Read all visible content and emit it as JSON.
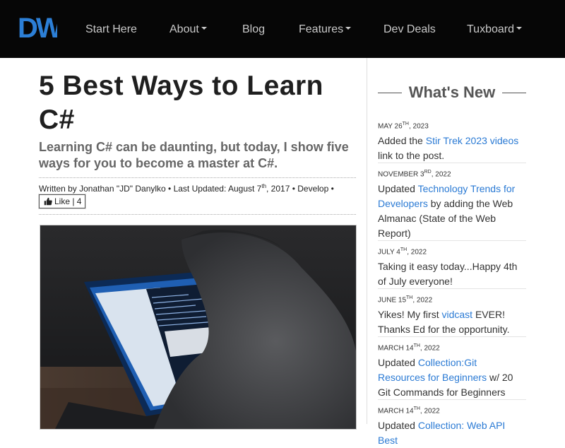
{
  "nav": {
    "logo": "DW",
    "brand_color": "#2c7fd6",
    "items": [
      {
        "label": "Start Here",
        "dropdown": false
      },
      {
        "label": "About",
        "dropdown": true
      },
      {
        "label": "Blog",
        "dropdown": false
      },
      {
        "label": "Features",
        "dropdown": true
      },
      {
        "label": "Dev Deals",
        "dropdown": false
      },
      {
        "label": "Tuxboard",
        "dropdown": true
      }
    ]
  },
  "article": {
    "title": "5 Best Ways to Learn C#",
    "subtitle": "Learning C# can be daunting, but today, I show five ways for you to become a master at C#.",
    "byline_prefix": "Written by Jonathan \"JD\" Danylko • Last Updated: August 7",
    "byline_sup": "th",
    "byline_suffix": ", 2017 • Develop •",
    "like_label": "Like | 4",
    "like_icon": "thumbs-up-icon",
    "image_alt": "Person coding on a laptop"
  },
  "sidebar": {
    "heading": "What's New",
    "link_color": "#2a7ad4",
    "items": [
      {
        "date_pre": "May 26",
        "date_sup": "th",
        "date_post": ", 2023",
        "before": "Added the ",
        "link": "Stir Trek 2023 videos",
        "after": " link to the post."
      },
      {
        "date_pre": "November 3",
        "date_sup": "rd",
        "date_post": ", 2022",
        "before": "Updated ",
        "link": "Technology Trends for Developers",
        "after": " by adding the Web Almanac (State of the Web Report)"
      },
      {
        "date_pre": "July 4",
        "date_sup": "th",
        "date_post": ", 2022",
        "before": "Taking it easy today...Happy 4th of July everyone!",
        "link": "",
        "after": ""
      },
      {
        "date_pre": "June 15",
        "date_sup": "th",
        "date_post": ", 2022",
        "before": "Yikes! My first ",
        "link": "vidcast",
        "after": " EVER! Thanks Ed for the opportunity."
      },
      {
        "date_pre": "March 14",
        "date_sup": "th",
        "date_post": ", 2022",
        "before": "Updated ",
        "link": "Collection:Git Resources for Beginners",
        "after": " w/ 20 Git Commands for Beginners"
      },
      {
        "date_pre": "March 14",
        "date_sup": "th",
        "date_post": ", 2022",
        "before": "Updated ",
        "link": "Collection: Web API Best",
        "after": ""
      }
    ]
  }
}
